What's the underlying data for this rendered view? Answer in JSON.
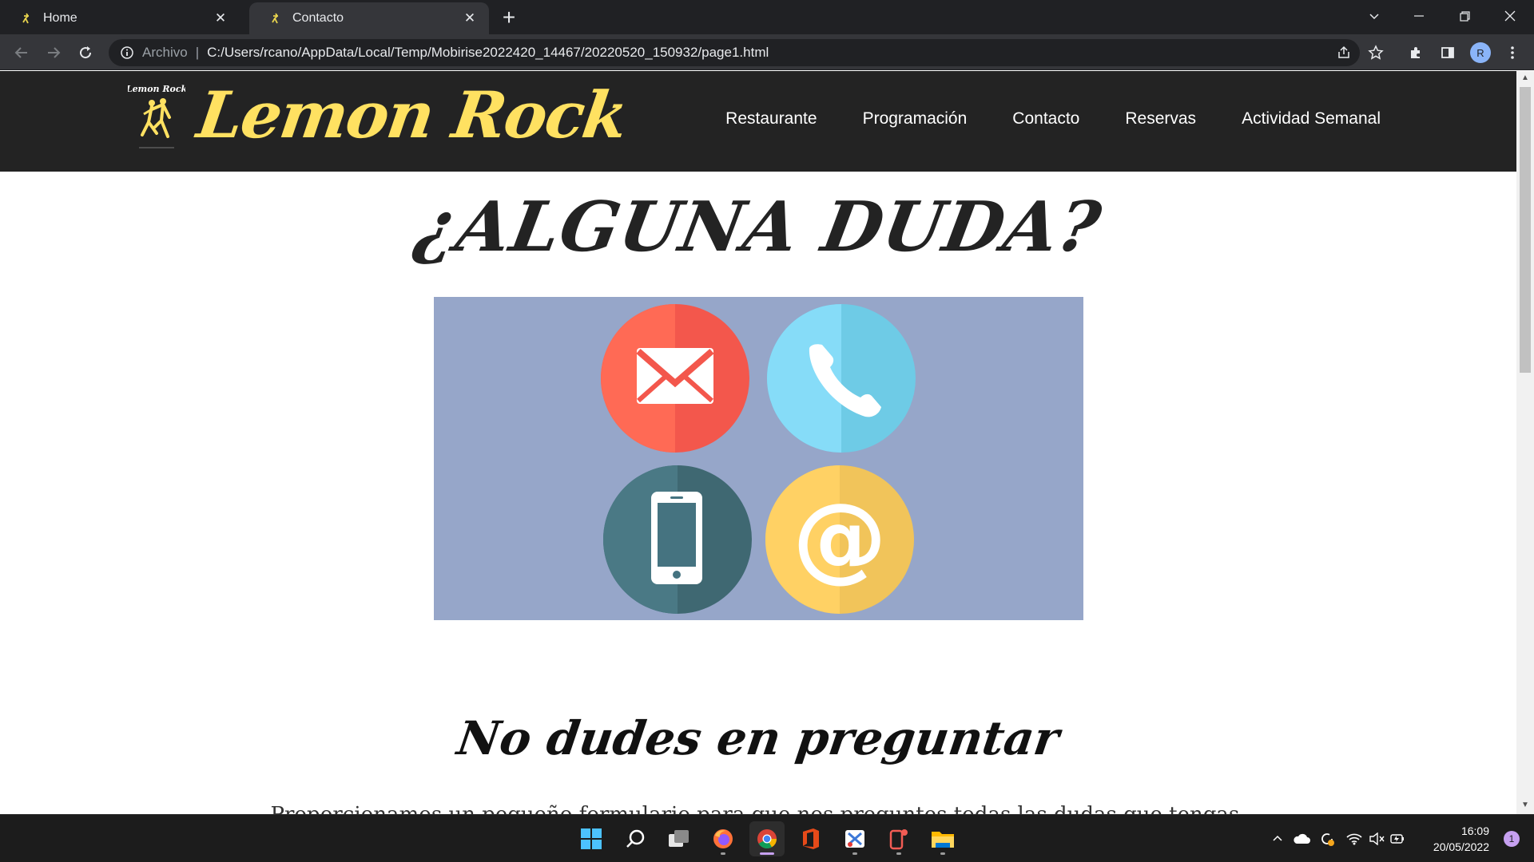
{
  "browser": {
    "tabs": [
      {
        "title": "Home",
        "active": false
      },
      {
        "title": "Contacto",
        "active": true
      }
    ],
    "address": {
      "scheme_label": "Archivo",
      "url": "C:/Users/rcano/AppData/Local/Temp/Mobirise2022420_14467/20220520_150932/page1.html"
    },
    "profile_initial": "R"
  },
  "site": {
    "logo_small_text": "Lemon Rock",
    "logo_text": "Lemon Rock",
    "nav": [
      "Restaurante",
      "Programación",
      "Contacto",
      "Reservas",
      "Actividad Semanal"
    ],
    "headline": "¿ALGUNA DUDA?",
    "subheadline": "No dudes en preguntar",
    "body": "Proporcionamos un pequeño formulario para que nos preguntes todas las dudas que tengas.",
    "image_icons": [
      "email-icon",
      "phone-icon",
      "mobile-icon",
      "at-sign-icon"
    ],
    "colors": {
      "header_bg": "#232323",
      "logo_yellow": "#ffe161",
      "image_bg": "#96a6c9",
      "email": "#f3574c",
      "phone": "#80d5f3",
      "mobile": "#457380",
      "at": "#fecb5c"
    }
  },
  "taskbar": {
    "apps": [
      "start-icon",
      "search-icon",
      "task-view-icon",
      "firefox-icon",
      "chrome-icon",
      "office-icon",
      "snipping-icon",
      "phone-link-icon",
      "file-explorer-icon"
    ],
    "time": "16:09",
    "date": "20/05/2022",
    "notification_count": "1"
  }
}
